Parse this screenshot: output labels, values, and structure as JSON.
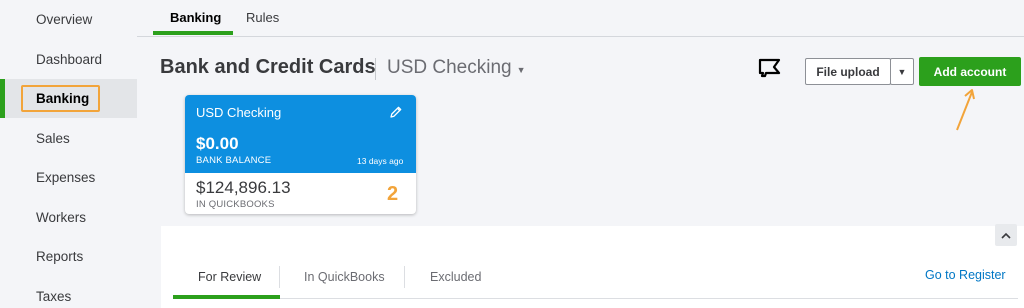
{
  "sidebar": {
    "items": [
      {
        "label": "Overview"
      },
      {
        "label": "Dashboard"
      },
      {
        "label": "Banking"
      },
      {
        "label": "Sales"
      },
      {
        "label": "Expenses"
      },
      {
        "label": "Workers"
      },
      {
        "label": "Reports"
      },
      {
        "label": "Taxes"
      }
    ],
    "active": "Banking"
  },
  "top_tabs": [
    {
      "label": "Banking"
    },
    {
      "label": "Rules"
    }
  ],
  "header": {
    "title": "Bank and Credit Cards",
    "account_select": "USD Checking",
    "file_upload_label": "File upload",
    "add_account_label": "Add account"
  },
  "account_card": {
    "name": "USD Checking",
    "bank_balance": "$0.00",
    "bank_balance_label": "BANK BALANCE",
    "updated": "13 days ago",
    "qb_balance": "$124,896.13",
    "qb_balance_label": "IN QUICKBOOKS",
    "badge": "2"
  },
  "review_tabs": [
    {
      "label": "For Review"
    },
    {
      "label": "In QuickBooks"
    },
    {
      "label": "Excluded"
    }
  ],
  "goto_register": "Go to Register",
  "colors": {
    "accent_green": "#2ca01c",
    "card_blue": "#0d8fe0",
    "highlight_orange": "#f2a43a",
    "link_blue": "#0077c5"
  },
  "icons": [
    "megaphone-icon",
    "pencil-icon",
    "chevron-down-icon",
    "chevron-up-icon",
    "annotation-arrow-icon"
  ]
}
